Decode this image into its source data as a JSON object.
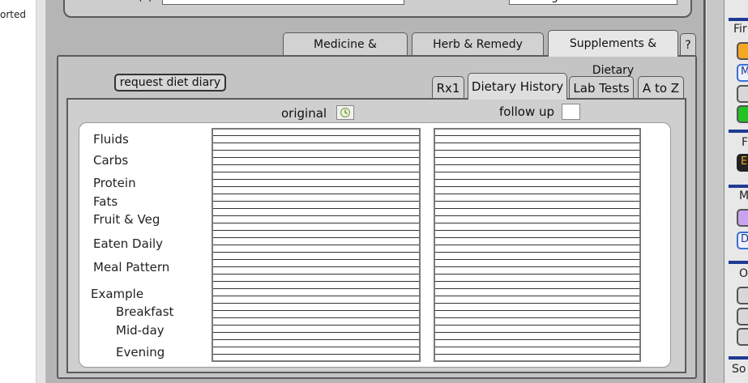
{
  "left_strip": {
    "text": "orted"
  },
  "top_fields": {
    "label": "(?)",
    "value2": "g"
  },
  "outer_tabs": [
    {
      "label": "Medicine & Treatment",
      "active": false
    },
    {
      "label": "Herb & Remedy History",
      "active": false
    },
    {
      "label": "Supplements & Dietary",
      "active": true
    },
    {
      "label": "?",
      "active": false
    }
  ],
  "request_button": "request diet diary",
  "inner_tabs": [
    {
      "label": "Rx1",
      "active": false
    },
    {
      "label": "Dietary History",
      "active": true
    },
    {
      "label": "Lab Tests",
      "active": false
    },
    {
      "label": "A to Z",
      "active": false
    }
  ],
  "original_label": "original",
  "followup_label": "follow up",
  "row_labels": {
    "fluids": "Fluids",
    "carbs": "Carbs",
    "protein": "Protein",
    "fats": "Fats",
    "fruit_veg": "Fruit & Veg",
    "eaten_daily": "Eaten Daily",
    "meal_pattern": "Meal Pattern",
    "example": "Example",
    "breakfast": "Breakfast",
    "midday": "Mid-day",
    "evening": "Evening"
  },
  "right_sidebar": {
    "labels": [
      "Fir",
      "F",
      "M",
      "O",
      "So"
    ],
    "colors": {
      "orange": "#f5a623",
      "blue": "#3b6fd8",
      "green": "#22c322",
      "purple": "#c9a3f0",
      "dark": "#222222",
      "accent": "#1f3a93"
    },
    "button_letters": [
      "M",
      "D",
      "E"
    ]
  }
}
